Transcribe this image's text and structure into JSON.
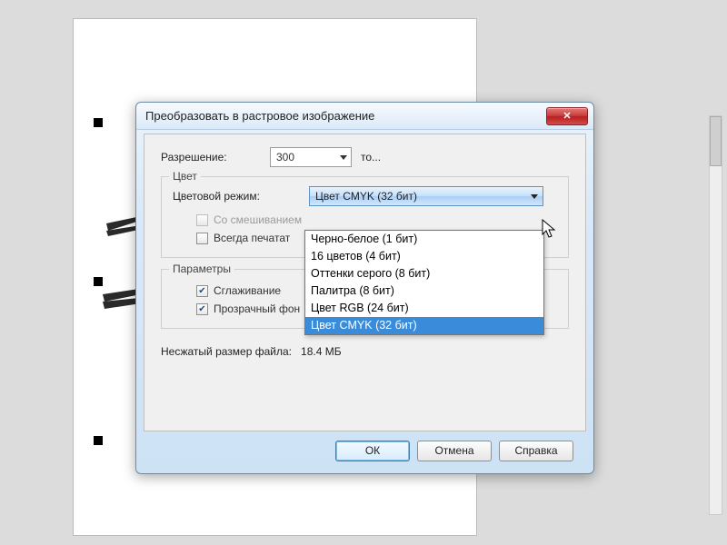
{
  "dialog": {
    "title": "Преобразовать в растровое изображение",
    "resolution_label": "Разрешение:",
    "resolution_value": "300",
    "units_label": "то...",
    "group_color_legend": "Цвет",
    "color_mode_label": "Цветовой режим:",
    "color_mode_value": "Цвет CMYK (32 бит)",
    "options": [
      "Черно-белое (1 бит)",
      "16 цветов (4 бит)",
      "Оттенки серого (8 бит)",
      "Палитра (8 бит)",
      "Цвет RGB (24 бит)",
      "Цвет CMYK (32 бит)"
    ],
    "selected_option_index": 5,
    "cb_dither_label": "Со смешиванием",
    "cb_overprint_label": "Всегда печатат",
    "group_params_legend": "Параметры",
    "cb_antialias_label": "Сглаживание",
    "cb_transparent_label": "Прозрачный фон",
    "filesize_label": "Несжатый размер файла:",
    "filesize_value": "18.4 МБ",
    "btn_ok": "ОК",
    "btn_cancel": "Отмена",
    "btn_help": "Справка"
  }
}
